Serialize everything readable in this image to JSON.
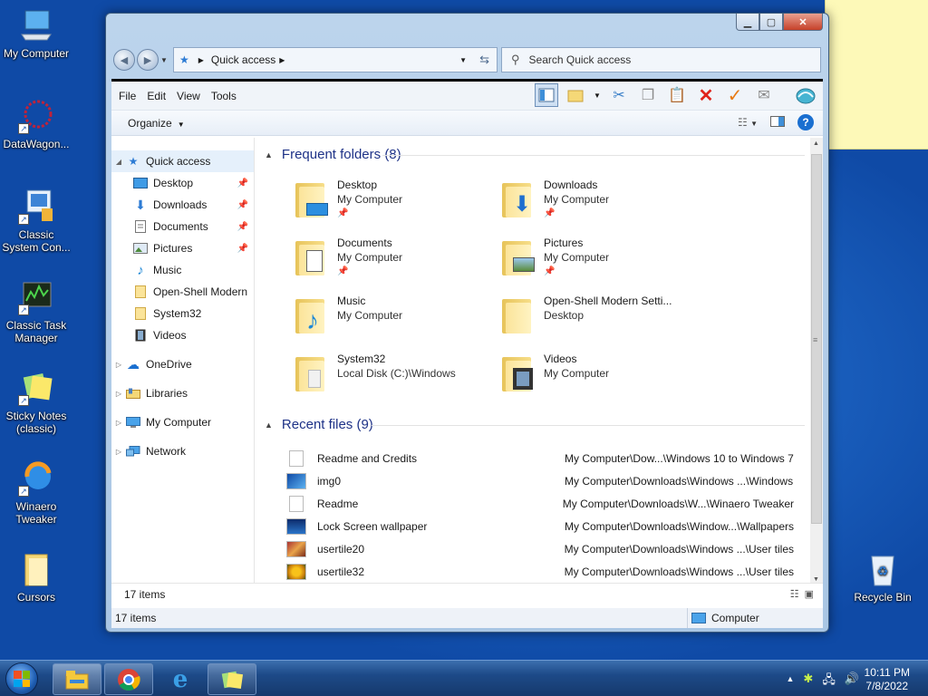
{
  "desktop": {
    "icons": [
      {
        "label": "My Computer",
        "icon": "computer-icon"
      },
      {
        "label": "DataWagon...",
        "icon": "datawagon-icon"
      },
      {
        "label": "Classic System Con...",
        "icon": "control-panel-icon"
      },
      {
        "label": "Classic Task Manager",
        "icon": "task-manager-icon"
      },
      {
        "label": "Sticky Notes (classic)",
        "icon": "sticky-notes-icon"
      },
      {
        "label": "Winaero Tweaker",
        "icon": "winaero-icon"
      },
      {
        "label": "Cursors",
        "icon": "folder-icon"
      },
      {
        "label": "Recycle Bin",
        "icon": "recycle-bin-icon"
      }
    ]
  },
  "window": {
    "address": {
      "location": "Quick access"
    },
    "search": {
      "placeholder": "Search Quick access"
    },
    "menu": [
      "File",
      "Edit",
      "View",
      "Tools"
    ],
    "organize_label": "Organize",
    "nav": {
      "quick_access": "Quick access",
      "items": [
        {
          "label": "Desktop",
          "pinned": true
        },
        {
          "label": "Downloads",
          "pinned": true
        },
        {
          "label": "Documents",
          "pinned": true
        },
        {
          "label": "Pictures",
          "pinned": true
        },
        {
          "label": "Music",
          "pinned": false
        },
        {
          "label": "Open-Shell Modern",
          "pinned": false
        },
        {
          "label": "System32",
          "pinned": false
        },
        {
          "label": "Videos",
          "pinned": false
        }
      ],
      "roots": [
        "OneDrive",
        "Libraries",
        "My Computer",
        "Network"
      ]
    },
    "frequent": {
      "heading": "Frequent folders (8)",
      "folders": [
        {
          "name": "Desktop",
          "location": "My Computer",
          "pinned": true
        },
        {
          "name": "Downloads",
          "location": "My Computer",
          "pinned": true
        },
        {
          "name": "Documents",
          "location": "My Computer",
          "pinned": true
        },
        {
          "name": "Pictures",
          "location": "My Computer",
          "pinned": true
        },
        {
          "name": "Music",
          "location": "My Computer",
          "pinned": false
        },
        {
          "name": "Open-Shell Modern Setti...",
          "location": "Desktop",
          "pinned": false
        },
        {
          "name": "System32",
          "location": "Local Disk (C:)\\Windows",
          "pinned": false
        },
        {
          "name": "Videos",
          "location": "My Computer",
          "pinned": false
        }
      ]
    },
    "recent": {
      "heading": "Recent files (9)",
      "files": [
        {
          "name": "Readme and Credits",
          "path": "My Computer\\Dow...\\Windows 10 to Windows 7"
        },
        {
          "name": "img0",
          "path": "My Computer\\Downloads\\Windows ...\\Windows"
        },
        {
          "name": "Readme",
          "path": "My Computer\\Downloads\\W...\\Winaero Tweaker"
        },
        {
          "name": "Lock Screen wallpaper",
          "path": "My Computer\\Downloads\\Window...\\Wallpapers"
        },
        {
          "name": "usertile20",
          "path": "My Computer\\Downloads\\Windows ...\\User tiles"
        },
        {
          "name": "usertile32",
          "path": "My Computer\\Downloads\\Windows ...\\User tiles"
        }
      ]
    },
    "status_items": "17 items",
    "statusbar_items": "17 items",
    "statusbar_location": "Computer"
  },
  "taskbar": {
    "time": "10:11 PM",
    "date": "7/8/2022"
  }
}
